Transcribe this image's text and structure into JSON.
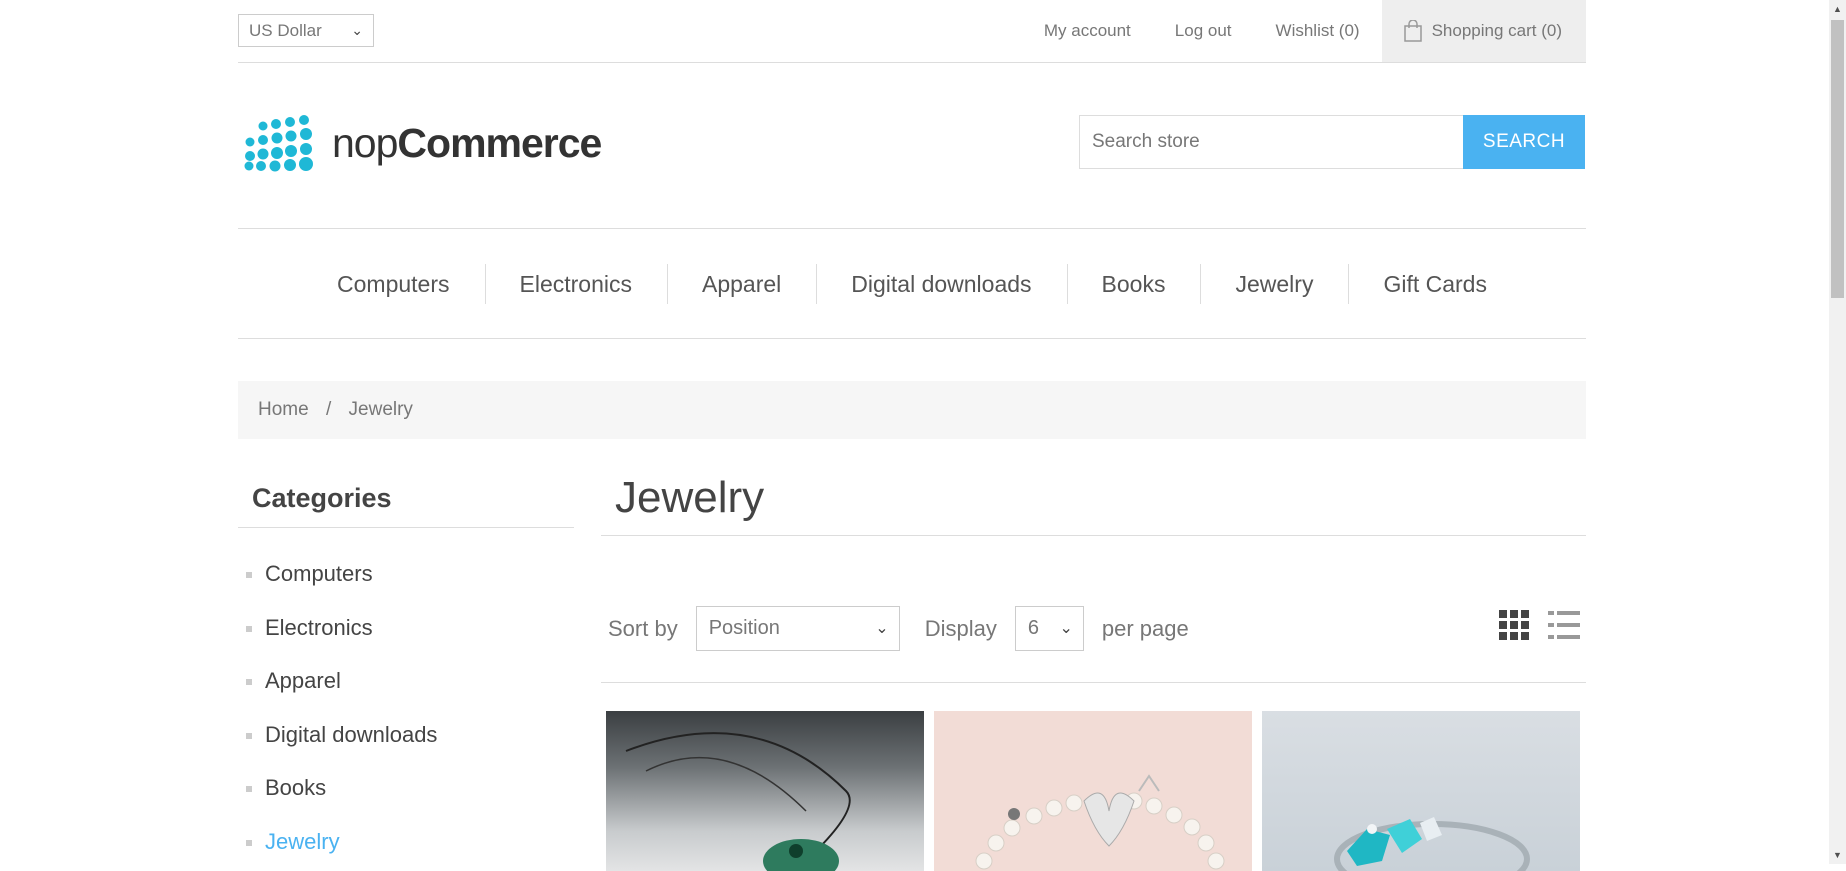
{
  "header": {
    "currency": "US Dollar",
    "links": [
      "My account",
      "Log out",
      "Wishlist (0)"
    ],
    "cart": "Shopping cart (0)"
  },
  "logo": {
    "part1": "nop",
    "part2": "Commerce",
    "color": "#1fb8d6"
  },
  "search": {
    "placeholder": "Search store",
    "button": "SEARCH"
  },
  "menu": [
    "Computers",
    "Electronics",
    "Apparel",
    "Digital downloads",
    "Books",
    "Jewelry",
    "Gift Cards"
  ],
  "breadcrumb": {
    "home": "Home",
    "separator": "/",
    "current": "Jewelry"
  },
  "sidebar": {
    "title": "Categories",
    "items": [
      "Computers",
      "Electronics",
      "Apparel",
      "Digital downloads",
      "Books",
      "Jewelry"
    ],
    "active": "Jewelry"
  },
  "main": {
    "title": "Jewelry",
    "sort_label": "Sort by",
    "sort_value": "Position",
    "display_label": "Display",
    "display_value": "6",
    "per_page_label": "per page"
  },
  "colors": {
    "accent": "#4ab2f1"
  }
}
